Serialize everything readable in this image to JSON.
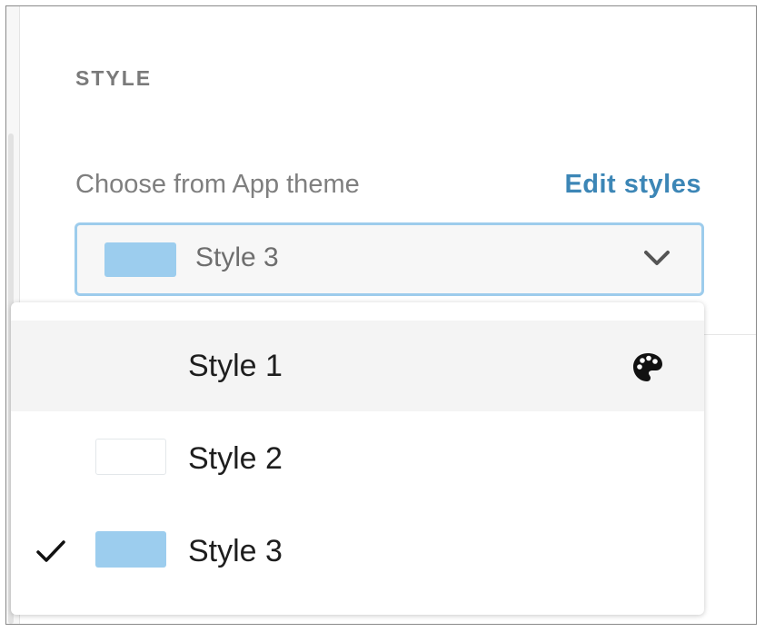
{
  "section": {
    "title": "STYLE"
  },
  "theme_picker": {
    "label": "Choose from App theme",
    "edit_link": "Edit styles",
    "selected": {
      "label": "Style 3",
      "swatch_color": "#9ccdee"
    },
    "chevron_icon": "chevron-down-icon"
  },
  "options": [
    {
      "label": "Style 1",
      "swatch_color": null,
      "selected": false,
      "hovered": true,
      "trailing_icon": "palette-icon"
    },
    {
      "label": "Style 2",
      "swatch_color": "#ffffff",
      "selected": false,
      "hovered": false,
      "trailing_icon": null
    },
    {
      "label": "Style 3",
      "swatch_color": "#9ccdee",
      "selected": true,
      "hovered": false,
      "trailing_icon": null
    }
  ],
  "colors": {
    "accent": "#3c86b6",
    "focus_border": "#9dccec",
    "hover_bg": "#f4f4f4"
  }
}
